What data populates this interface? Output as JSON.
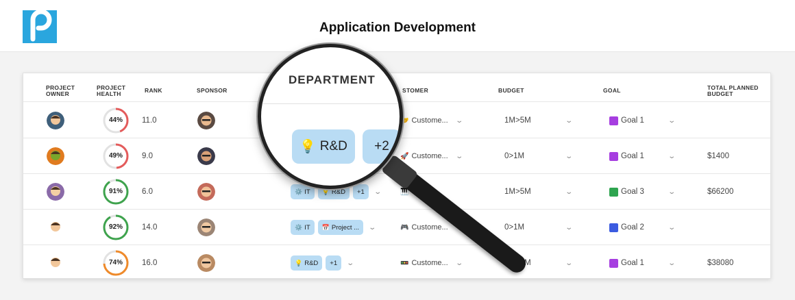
{
  "header": {
    "title": "Application Development"
  },
  "columns": {
    "owner": "Project Owner",
    "health": "Project Health",
    "rank": "Rank",
    "sponsor": "Sponsor",
    "customer": "stomer",
    "budget": "Budget",
    "goal": "Goal",
    "total": "Total Planned Budget"
  },
  "rows": [
    {
      "health": "44%",
      "health_value": 0.44,
      "health_color": "#e45b5b",
      "rank": "11.0",
      "depts": [],
      "customer_icon": "🤝",
      "customer": "Custome...",
      "budget": "1M>5M",
      "goal_color": "#a63ee0",
      "goal": "Goal 1",
      "total": ""
    },
    {
      "health": "49%",
      "health_value": 0.49,
      "health_color": "#e45b5b",
      "rank": "9.0",
      "depts": [],
      "customer_icon": "🚀",
      "customer": "Custome...",
      "budget": "0>1M",
      "goal_color": "#a63ee0",
      "goal": "Goal 1",
      "total": "$1400"
    },
    {
      "health": "91%",
      "health_value": 0.91,
      "health_color": "#3ea34d",
      "rank": "6.0",
      "depts": [
        {
          "icon": "⚙️",
          "label": "IT"
        },
        {
          "icon": "💡",
          "label": "R&D"
        },
        {
          "icon": "",
          "label": "+1"
        }
      ],
      "customer_icon": "🎹",
      "customer": "Cu",
      "budget": "1M>5M",
      "goal_color": "#2ea44f",
      "goal": "Goal 3",
      "total": "$66200"
    },
    {
      "health": "92%",
      "health_value": 0.92,
      "health_color": "#3ea34d",
      "rank": "14.0",
      "depts": [
        {
          "icon": "⚙️",
          "label": "IT"
        },
        {
          "icon": "📅",
          "label": "Project ..."
        }
      ],
      "customer_icon": "🎮",
      "customer": "Custome...",
      "budget": "0>1M",
      "goal_color": "#3b5be0",
      "goal": "Goal 2",
      "total": ""
    },
    {
      "health": "74%",
      "health_value": 0.74,
      "health_color": "#ef8a2a",
      "rank": "16.0",
      "depts": [
        {
          "icon": "💡",
          "label": "R&D"
        },
        {
          "icon": "",
          "label": "+1"
        }
      ],
      "customer_icon": "🚥",
      "customer": "Custome...",
      "budget": "1M>5M",
      "goal_color": "#a63ee0",
      "goal": "Goal 1",
      "total": "$38080"
    }
  ],
  "magnifier": {
    "header": "DEPARTMENT",
    "chip_icon": "💡",
    "chip_label": "R&D",
    "more_label": "+2"
  },
  "colors": {
    "brand": "#2aa6de",
    "chip_bg": "#b9dcf4"
  }
}
